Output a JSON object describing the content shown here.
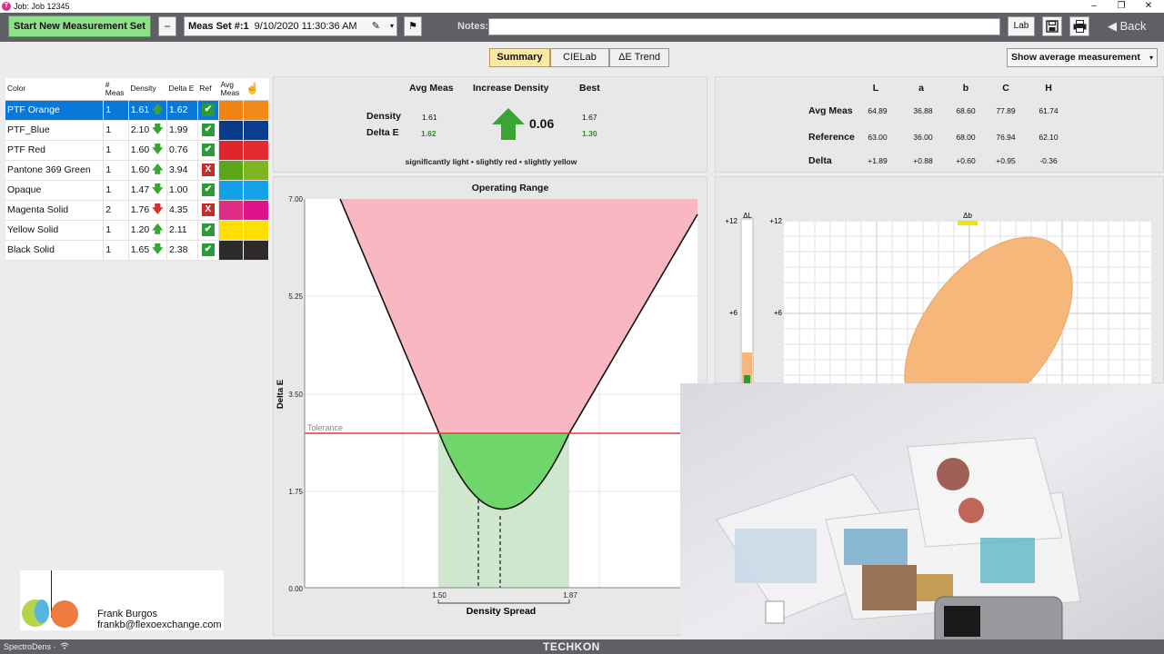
{
  "window": {
    "title": "Job: Job 12345",
    "logo": "T",
    "controls": {
      "minimize": "–",
      "restore": "❐",
      "close": "✕"
    }
  },
  "toolbar": {
    "start_label": "Start New Measurement Set",
    "minus_label": "−",
    "meas_set_label": "Meas Set #:1",
    "meas_set_date": "9/10/2020 11:30:36 AM",
    "notes_label": "Notes:",
    "notes_value": "",
    "lab_label": "Lab",
    "back_label": "Back",
    "icons": {
      "edit": "pencil-icon",
      "flag": "flag-icon",
      "save": "save-icon",
      "print": "printer-icon",
      "back": "back-arrow-icon"
    }
  },
  "tabs": [
    {
      "label": "Summary",
      "active": true
    },
    {
      "label": "CIELab",
      "active": false
    },
    {
      "label": "ΔE Trend",
      "active": false
    }
  ],
  "display_select": {
    "value": "Show average measurement"
  },
  "color_table": {
    "headers": {
      "color": "Color",
      "meas": "# Meas",
      "density": "Density",
      "deltae": "Delta E",
      "ref": "Ref",
      "avg": "Avg Meas"
    },
    "rows": [
      {
        "name": "PTF Orange",
        "meas": "1",
        "density": "1.61",
        "dir": "up",
        "deltae": "1.62",
        "pass": true,
        "ref": "#f08412",
        "avg": "#f28a1a",
        "selected": true
      },
      {
        "name": "PTF_Blue",
        "meas": "1",
        "density": "2.10",
        "dir": "down",
        "deltae": "1.99",
        "pass": true,
        "ref": "#0a3a8a",
        "avg": "#0a3d8f",
        "selected": false
      },
      {
        "name": "PTF Red",
        "meas": "1",
        "density": "1.60",
        "dir": "down",
        "deltae": "0.76",
        "pass": true,
        "ref": "#e0252c",
        "avg": "#e22a30",
        "selected": false
      },
      {
        "name": "Pantone 369 Green",
        "meas": "1",
        "density": "1.60",
        "dir": "up",
        "deltae": "3.94",
        "pass": false,
        "ref": "#58a81a",
        "avg": "#7fb523",
        "selected": false
      },
      {
        "name": "Opaque",
        "meas": "1",
        "density": "1.47",
        "dir": "down",
        "deltae": "1.00",
        "pass": true,
        "ref": "#12a0e6",
        "avg": "#16a2e8",
        "selected": false
      },
      {
        "name": "Magenta Solid",
        "meas": "2",
        "density": "1.76",
        "dir": "down-red",
        "deltae": "4.35",
        "pass": false,
        "ref": "#de2f87",
        "avg": "#e0148a",
        "selected": false
      },
      {
        "name": "Yellow Solid",
        "meas": "1",
        "density": "1.20",
        "dir": "up",
        "deltae": "2.11",
        "pass": true,
        "ref": "#ffe000",
        "avg": "#ffe100",
        "selected": false
      },
      {
        "name": "Black Solid",
        "meas": "1",
        "density": "1.65",
        "dir": "down",
        "deltae": "2.38",
        "pass": true,
        "ref": "#2b2b2b",
        "avg": "#2e2a29",
        "selected": false
      }
    ]
  },
  "summary": {
    "col_avg": "Avg Meas",
    "col_inc": "Increase Density",
    "col_best": "Best",
    "row_density": "Density",
    "row_deltae": "Delta E",
    "avg_density": "1.61",
    "avg_deltae": "1.62",
    "increase": "0.06",
    "best_density": "1.67",
    "best_deltae": "1.30",
    "note": "significantly light • slightly red • slightly yellow",
    "accent": "#3aa535"
  },
  "lab": {
    "headers": [
      "L",
      "a",
      "b",
      "C",
      "H"
    ],
    "rows": [
      {
        "label": "Avg Meas",
        "values": [
          "64.89",
          "36.88",
          "68.60",
          "77.89",
          "61.74"
        ]
      },
      {
        "label": "Reference",
        "values": [
          "63.00",
          "36.00",
          "68.00",
          "76.94",
          "62.10"
        ]
      },
      {
        "label": "Delta",
        "values": [
          "+1.89",
          "+0.88",
          "+0.60",
          "+0.95",
          "-0.36"
        ]
      }
    ]
  },
  "operating_range": {
    "title": "Operating Range",
    "ylabel": "Delta E",
    "xlabel": "Density Spread",
    "y_ticks": [
      "7.00",
      "5.25",
      "3.50",
      "1.75",
      "0.00"
    ],
    "x_ticks": [
      "1.50",
      "1.87"
    ],
    "tolerance_label": "Tolerance",
    "tolerance": 2.8,
    "ylim": [
      0,
      7
    ],
    "colors": {
      "fail": "#f9b7c1",
      "pass": "#6ed66b",
      "band": "#cfe7cc",
      "tolerance_line": "#e03a3a"
    }
  },
  "ab_chart": {
    "dl_label": "ΔL",
    "db_label": "Δb",
    "y_ticks_left": [
      "+12",
      "+6"
    ],
    "y_ticks_right": [
      "+12",
      "+6"
    ],
    "colors": {
      "ellipse": "#f5b87a",
      "marker": "#f2e600",
      "dl_bar": "#f5b87a",
      "dl_marker": "#2a9a3b"
    }
  },
  "contact_card": {
    "name": "Frank Burgos",
    "email": "frankb@flexoexchange.com"
  },
  "statusbar": {
    "device": "SpectroDens ·",
    "wifi": "wifi-icon",
    "brand": "TECHKON"
  }
}
